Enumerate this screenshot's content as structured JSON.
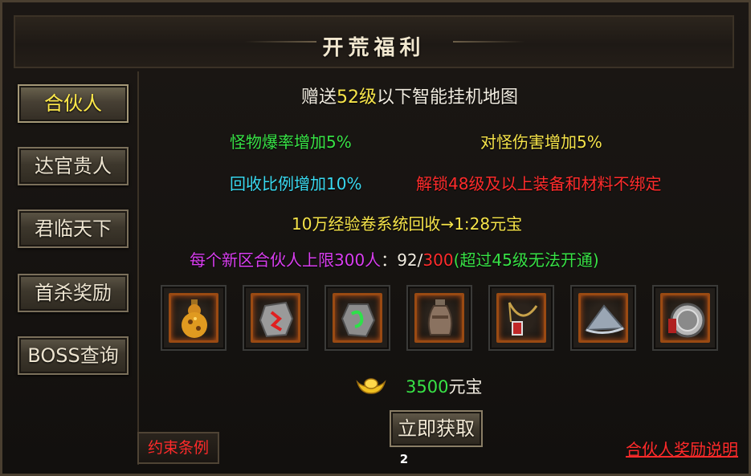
{
  "window": {
    "title": "开荒福利"
  },
  "sidebar": {
    "items": [
      {
        "label": "合伙人",
        "active": true
      },
      {
        "label": "达官贵人",
        "active": false
      },
      {
        "label": "君临天下",
        "active": false
      },
      {
        "label": "首杀奖励",
        "active": false
      },
      {
        "label": "BOSS查询",
        "active": false
      }
    ]
  },
  "main": {
    "headline": {
      "prefix": "赠送",
      "level": "52级",
      "suffix": "以下智能挂机地图"
    },
    "perks": {
      "drop_rate": "怪物爆率增加5%",
      "damage": "对怪伤害增加5%",
      "recycle": "回收比例增加10%",
      "unlock": "解锁48级及以上装备和材料不绑定"
    },
    "exp_scroll": "10万经验卷系统回收→1:28元宝",
    "limit": {
      "label": "每个新区合伙人上限300人",
      "colon": "：",
      "current": "92",
      "slash": "/",
      "max": "300",
      "note": "(超过45级无法开通)"
    },
    "items": [
      {
        "icon": "golden-gourd-icon"
      },
      {
        "icon": "red-rune-stone-icon"
      },
      {
        "icon": "green-rune-stone-icon"
      },
      {
        "icon": "clay-vase-icon"
      },
      {
        "icon": "amulet-necklace-icon"
      },
      {
        "icon": "straw-hat-icon"
      },
      {
        "icon": "medal-token-icon"
      }
    ],
    "reward": {
      "amount": "3500",
      "unit": "元宝"
    },
    "get_button": "立即获取",
    "badge": "2"
  },
  "footer": {
    "rules_label": "约束条例",
    "explain_link": "合伙人奖励说明"
  },
  "colors": {
    "yellow": "#f6e44a",
    "green": "#38e246",
    "cyan": "#39d9f0",
    "red": "#ff2c2c",
    "magenta": "#d93ef0"
  }
}
